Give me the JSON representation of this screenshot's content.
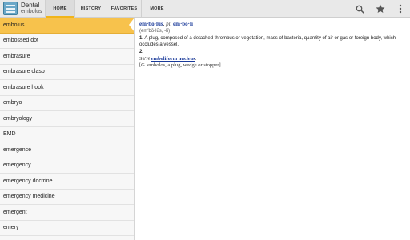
{
  "app": {
    "title": "Dental",
    "subtitle": "embolus"
  },
  "tabs": [
    {
      "label": "HOME",
      "active": true
    },
    {
      "label": "HISTORY",
      "active": false
    },
    {
      "label": "FAVORITES",
      "active": false
    },
    {
      "label": "MORE",
      "active": false
    }
  ],
  "actions": [
    {
      "icon": "search-icon"
    },
    {
      "icon": "star-icon"
    },
    {
      "icon": "overflow-menu-icon"
    }
  ],
  "word_list": {
    "selected_index": 0,
    "items": [
      "embolus",
      "embossed dot",
      "embrasure",
      "embrasure clasp",
      "embrasure hook",
      "embryo",
      "embryology",
      "EMD",
      "emergence",
      "emergency",
      "emergency doctrine",
      "emergency medicine",
      "emergent",
      "emery"
    ]
  },
  "definition": {
    "headword": "em·bo·lus",
    "plural_label": "pl.",
    "plural": "em·bo·li",
    "pronunciation": "(em′bō-lŭs, -lī)",
    "sense1_num": "1.",
    "sense1_text": "A plug, composed of a detached thrombus or vegetation, mass of bacteria, quantity of air or gas or foreign body, which occludes a vessel.",
    "sense2_num": "2.",
    "syn_label": "SYN",
    "syn_link": "emboliform nucleus",
    "syn_end": ".",
    "etymology": "[G. embolos, a plug, wedge or stopper]"
  },
  "colors": {
    "accent": "#f7c24c",
    "link": "#1a3a9a",
    "toolbar": "#e9e9e9"
  }
}
